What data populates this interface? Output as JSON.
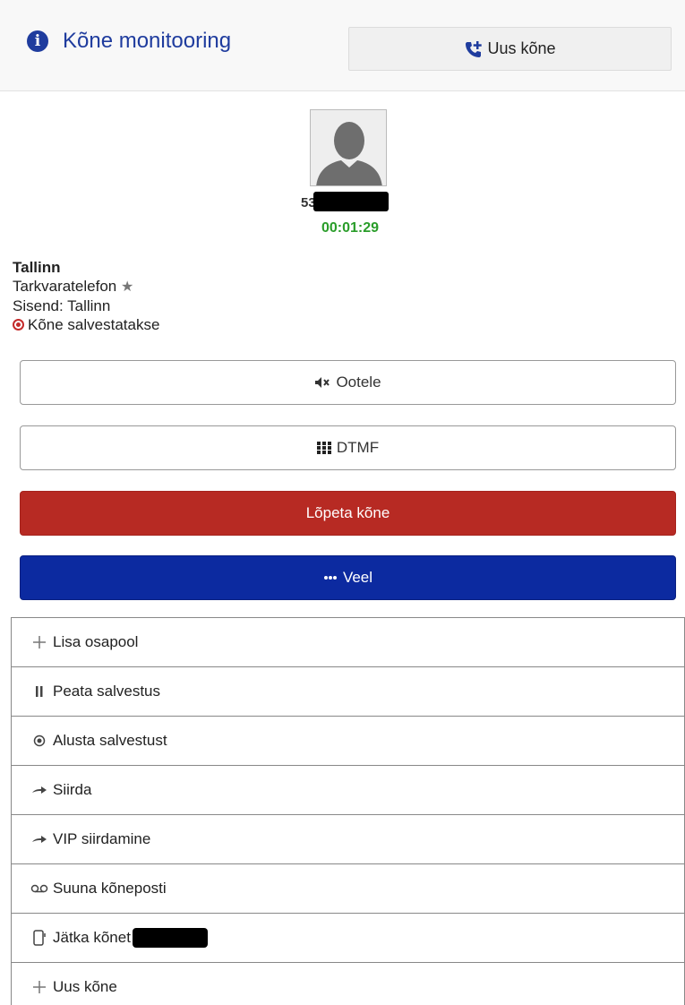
{
  "header": {
    "title": "Kõne monitooring",
    "new_call_label": "Uus kõne"
  },
  "caller": {
    "number_visible": "53",
    "timer": "00:01:29",
    "city": "Tallinn",
    "device": "Tarkvaratelefon",
    "input_line": "Sisend: Tallinn",
    "recording_status": "Kõne salvestatakse"
  },
  "actions": {
    "hold_label": "Ootele",
    "dtmf_label": "DTMF",
    "hangup_label": "Lõpeta kõne",
    "more_label": "Veel"
  },
  "menu": {
    "items": [
      {
        "label": "Lisa osapool",
        "icon": "plus-icon"
      },
      {
        "label": "Peata salvestus",
        "icon": "pause-icon"
      },
      {
        "label": "Alusta salvestust",
        "icon": "record-icon"
      },
      {
        "label": "Siirda",
        "icon": "arrow-right-icon"
      },
      {
        "label": "VIP siirdamine",
        "icon": "arrow-right-icon"
      },
      {
        "label": "Suuna kõneposti",
        "icon": "voicemail-icon"
      },
      {
        "label": "Jätka kõnet",
        "icon": "mobile-icon"
      },
      {
        "label": "Uus kõne",
        "icon": "plus-icon"
      }
    ]
  },
  "colors": {
    "accent": "#1f3c9e",
    "timer": "#2a9d2a",
    "hangup": "#b72a23",
    "more": "#0c2aa0",
    "recording": "#c42b2b"
  }
}
